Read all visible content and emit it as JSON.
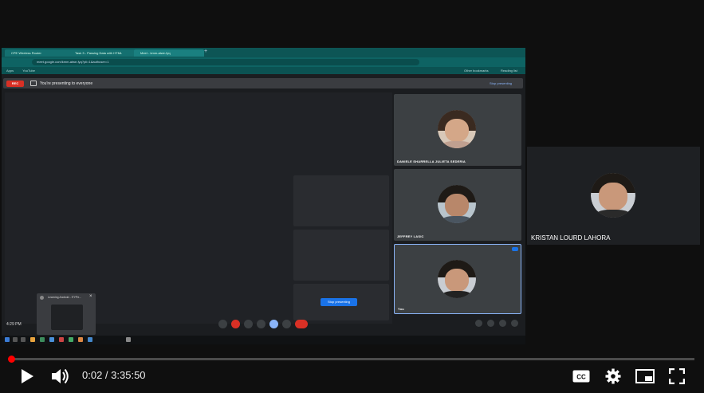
{
  "player": {
    "current_time": "0:02",
    "separator": " / ",
    "duration": "3:35:50",
    "progress_fraction": 0.0001,
    "accent": "#ff0000"
  },
  "meeting": {
    "rec_badge": "REC",
    "presenting_text": "You're presenting to everyone",
    "stop_presenting": "Stop presenting",
    "stop_presenting_button": "Stop presenting",
    "participants": [
      {
        "name": "DANIELE SHARRELLA JULIETA SEDERIA"
      },
      {
        "name": "JEFFREY LASIC"
      },
      {
        "name": "You"
      }
    ],
    "clock": "4:29 PM"
  },
  "browser": {
    "tabs": [
      {
        "label": "CPE Wireless Router"
      },
      {
        "label": "Task 3 - Passing Data with HTML"
      },
      {
        "label": "Meet - kmm-atwe-fyq"
      }
    ],
    "address": "meet.google.com/kmm-atwe-fyq?pli=1&authuser=1",
    "bookmarks": [
      "Apps",
      "YouTube"
    ],
    "bookmarks_right": [
      "Other bookmarks",
      "Reading list"
    ]
  },
  "popup": {
    "title": "Learning Android - ITYPe..."
  },
  "overlay_participant": {
    "name": "KRISTAN LOURD LAHORA"
  }
}
